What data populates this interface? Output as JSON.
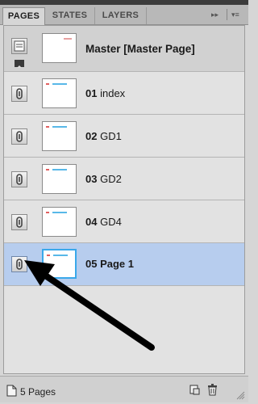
{
  "tabs": [
    {
      "label": "PAGES",
      "active": true
    },
    {
      "label": "STATES",
      "active": false
    },
    {
      "label": "LAYERS",
      "active": false
    }
  ],
  "panel_controls": {
    "collapse_glyph": "▸▸",
    "menu_glyph": "▾≡"
  },
  "master": {
    "label": "Master [Master Page]",
    "icon": "master-page-icon"
  },
  "pages": [
    {
      "num": "01",
      "name": "index",
      "selected": false,
      "icon": "page-link-icon"
    },
    {
      "num": "02",
      "name": "GD1",
      "selected": false,
      "icon": "page-link-icon"
    },
    {
      "num": "03",
      "name": "GD2",
      "selected": false,
      "icon": "page-link-icon"
    },
    {
      "num": "04",
      "name": "GD4",
      "selected": false,
      "icon": "page-link-icon"
    },
    {
      "num": "05",
      "name": "Page 1",
      "selected": true,
      "icon": "page-link-icon"
    }
  ],
  "footer": {
    "page_count": "5 Pages",
    "page_icon": "new-page-icon",
    "duplicate_icon": "duplicate-page-icon",
    "delete_icon": "trash-icon"
  },
  "colors": {
    "selected_row": "#b7cdee",
    "thumb_selected_border": "#3aa8ea",
    "annotation_arrow": "#000000"
  }
}
